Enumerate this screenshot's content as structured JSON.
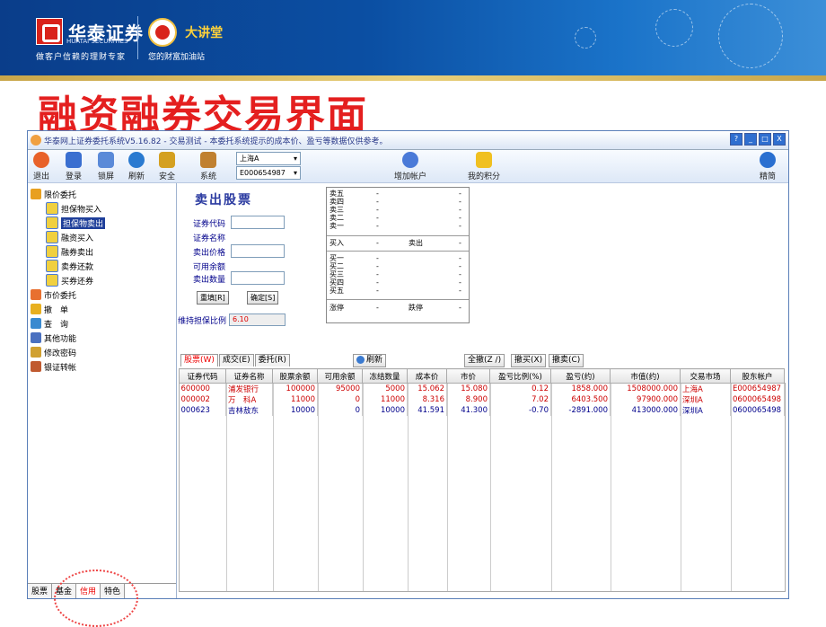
{
  "slide": {
    "title": "融资融券交易界面",
    "brand": {
      "name": "华泰证券",
      "en": "HUATAI SECURITIES",
      "motto": "做客户信赖的理财专家",
      "partner_name": "大讲堂",
      "partner_motto": "您的财富加油站"
    }
  },
  "window": {
    "title": "华泰网上证券委托系统V5.16.82 - 交易测试 - 本委托系统提示的成本价、盈亏等数据仅供参考。",
    "controls": [
      "?",
      "_",
      "□",
      "X"
    ]
  },
  "toolbar": {
    "items": [
      {
        "label": "退出",
        "icon": "exit-icon",
        "color": "#e8622a"
      },
      {
        "label": "登录",
        "icon": "login-icon",
        "color": "#3a6fd0"
      },
      {
        "label": "锁屏",
        "icon": "lock-screen-icon",
        "color": "#5a8ad8"
      },
      {
        "label": "刷新",
        "icon": "refresh-icon",
        "color": "#2a7ad0"
      },
      {
        "label": "安全",
        "icon": "security-icon",
        "color": "#d4a020"
      },
      {
        "label": "系统",
        "icon": "system-tools-icon",
        "color": "#c08030"
      }
    ],
    "market": "上海A",
    "account": "E000654987",
    "add_account": "增加帐户",
    "my_points": "我的积分",
    "compact": "精简"
  },
  "sidebar": {
    "items": [
      {
        "label": "限价委托",
        "icon": "limit-order-icon",
        "level": 0
      },
      {
        "label": "担保物买入",
        "icon": "collateral-buy-icon",
        "level": 1
      },
      {
        "label": "担保物卖出",
        "icon": "collateral-sell-icon",
        "level": 1,
        "selected": true
      },
      {
        "label": "融资买入",
        "icon": "margin-buy-icon",
        "level": 1
      },
      {
        "label": "融券卖出",
        "icon": "short-sell-icon",
        "level": 1
      },
      {
        "label": "卖券还款",
        "icon": "sell-repay-icon",
        "level": 1
      },
      {
        "label": "买券还券",
        "icon": "buy-return-icon",
        "level": 1
      },
      {
        "label": "市价委托",
        "icon": "market-order-icon",
        "level": 0
      },
      {
        "label": "撤　单",
        "icon": "cancel-order-icon",
        "level": 0
      },
      {
        "label": "查　询",
        "icon": "query-icon",
        "level": 0
      },
      {
        "label": "其他功能",
        "icon": "other-functions-icon",
        "level": 0
      },
      {
        "label": "修改密码",
        "icon": "change-password-icon",
        "level": 0
      },
      {
        "label": "银证转帐",
        "icon": "bank-transfer-icon",
        "level": 0
      }
    ],
    "tabs": [
      "股票",
      "基金",
      "信用",
      "特色"
    ],
    "active_tab": "信用"
  },
  "order_form": {
    "title": "卖出股票",
    "fields": [
      "证券代码",
      "证券名称",
      "卖出价格",
      "可用余额",
      "卖出数量"
    ],
    "reset": "重填[R]",
    "confirm": "确定[S]",
    "maintenance_label": "维持担保比例",
    "maintenance_value": "6.10"
  },
  "quote": {
    "sell": [
      {
        "label": "卖五",
        "price": "-",
        "vol": "-"
      },
      {
        "label": "卖四",
        "price": "-",
        "vol": "-"
      },
      {
        "label": "卖三",
        "price": "-",
        "vol": "-"
      },
      {
        "label": "卖二",
        "price": "-",
        "vol": "-"
      },
      {
        "label": "卖一",
        "price": "-",
        "vol": "-"
      }
    ],
    "mid": {
      "buy_label": "买入",
      "buy_val": "-",
      "sell_label": "卖出",
      "sell_val": "-"
    },
    "buy": [
      {
        "label": "买一",
        "price": "-",
        "vol": "-"
      },
      {
        "label": "买二",
        "price": "-",
        "vol": "-"
      },
      {
        "label": "买三",
        "price": "-",
        "vol": "-"
      },
      {
        "label": "买四",
        "price": "-",
        "vol": "-"
      },
      {
        "label": "买五",
        "price": "-",
        "vol": "-"
      }
    ],
    "limits": {
      "up_label": "涨停",
      "up_val": "-",
      "down_label": "跌停",
      "down_val": "-"
    }
  },
  "grid": {
    "tabs": [
      "股票(W)",
      "成交(E)",
      "委托(R)"
    ],
    "active_tab": "股票(W)",
    "refresh": "刷新",
    "actions": [
      "全撤(Z /)",
      "撤买(X)",
      "撤卖(C)"
    ],
    "columns": [
      "证券代码",
      "证券名称",
      "股票余额",
      "可用余额",
      "冻结数量",
      "成本价",
      "市价",
      "盈亏比例(%)",
      "盈亏(约)",
      "市值(约)",
      "交易市场",
      "股东帐户"
    ],
    "rows": [
      {
        "style": "red",
        "cells": [
          "600000",
          "浦发银行",
          "100000",
          "95000",
          "5000",
          "15.062",
          "15.080",
          "0.12",
          "1858.000",
          "1508000.000",
          "上海A",
          "E000654987"
        ]
      },
      {
        "style": "red",
        "cells": [
          "000002",
          "万　科A",
          "11000",
          "0",
          "11000",
          "8.316",
          "8.900",
          "7.02",
          "6403.500",
          "97900.000",
          "深圳A",
          "0600065498"
        ]
      },
      {
        "style": "blue",
        "cells": [
          "000623",
          "吉林敖东",
          "10000",
          "0",
          "10000",
          "41.591",
          "41.300",
          "-0.70",
          "-2891.000",
          "413000.000",
          "深圳A",
          "0600065498"
        ]
      }
    ]
  }
}
